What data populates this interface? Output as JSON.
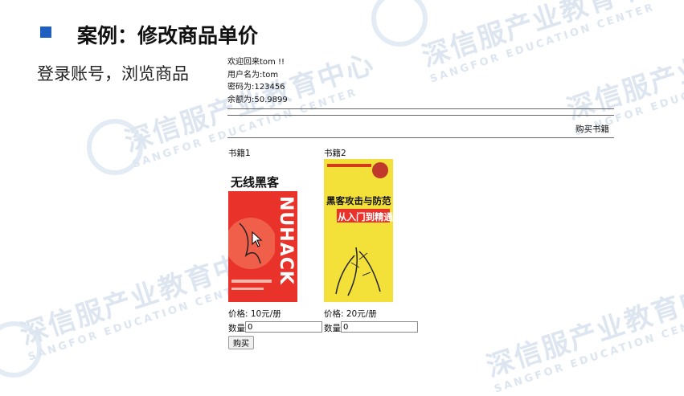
{
  "slide": {
    "title": "案例：修改商品单价",
    "subtitle": "登录账号，浏览商品",
    "accent_color": "#1f5fbf"
  },
  "watermark": {
    "text": "深信服产业教育中心",
    "english": "SANGFOR EDUCATION CENTER"
  },
  "user_info": {
    "welcome": "欢迎回来tom !!",
    "username": "用户名为:tom",
    "password": "密码为:123456",
    "balance": "余额为:50.9899"
  },
  "nav": {
    "buy_books": "购买书籍"
  },
  "books": [
    {
      "label": "书籍1",
      "price": "价格:  10元/册",
      "quantity_label": "数量",
      "quantity_value": "0",
      "cover": {
        "title": "无线黑客",
        "side_text": "NUHACK",
        "bg_color": "#e8322a"
      }
    },
    {
      "label": "书籍2",
      "price": "价格:  20元/册",
      "quantity_label": "数量",
      "quantity_value": "0",
      "cover": {
        "title": "黑客攻击与防范",
        "subtitle": "从入门到精通",
        "bg_color": "#f3e13a"
      }
    }
  ],
  "buy_button": "购买"
}
